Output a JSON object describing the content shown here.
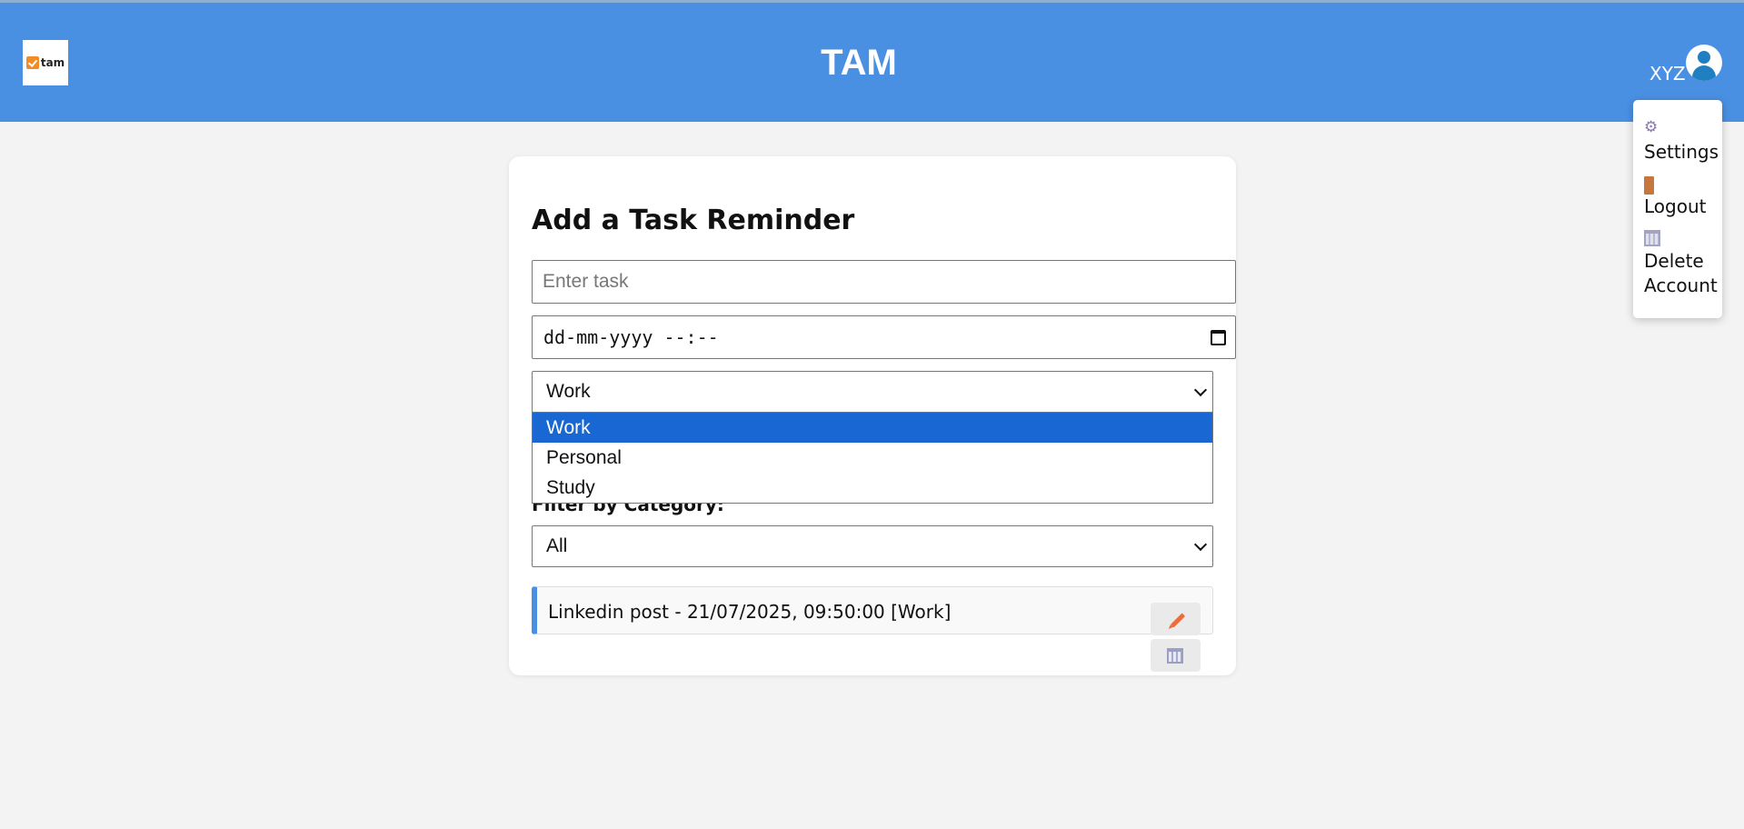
{
  "header": {
    "logo_text": "tam",
    "title": "TAM",
    "user": {
      "name": "XYZ"
    }
  },
  "user_menu": {
    "items": [
      {
        "label": "Settings",
        "icon": "gear-icon"
      },
      {
        "label": "Logout",
        "icon": "door-icon"
      },
      {
        "label": "Delete Account",
        "icon": "wastebasket-icon"
      }
    ]
  },
  "form": {
    "title": "Add a Task Reminder",
    "task_input": {
      "value": "",
      "placeholder": "Enter task"
    },
    "datetime_input": {
      "value": "dd-mm-yyyy --:--"
    },
    "category_select": {
      "selected": "Work",
      "options": [
        "Work",
        "Personal",
        "Study"
      ]
    }
  },
  "filter": {
    "label": "Filter by Category:",
    "selected": "All"
  },
  "tasks": [
    {
      "text": "Linkedin post - 21/07/2025, 09:50:00 [Work]",
      "actions": [
        "pencil-icon",
        "wastebasket-icon"
      ]
    }
  ],
  "colors": {
    "header": "#4a90e2",
    "selected_option": "#1967d2",
    "task_accent": "#4a90e2",
    "edit_icon": "#ef6b3a"
  }
}
